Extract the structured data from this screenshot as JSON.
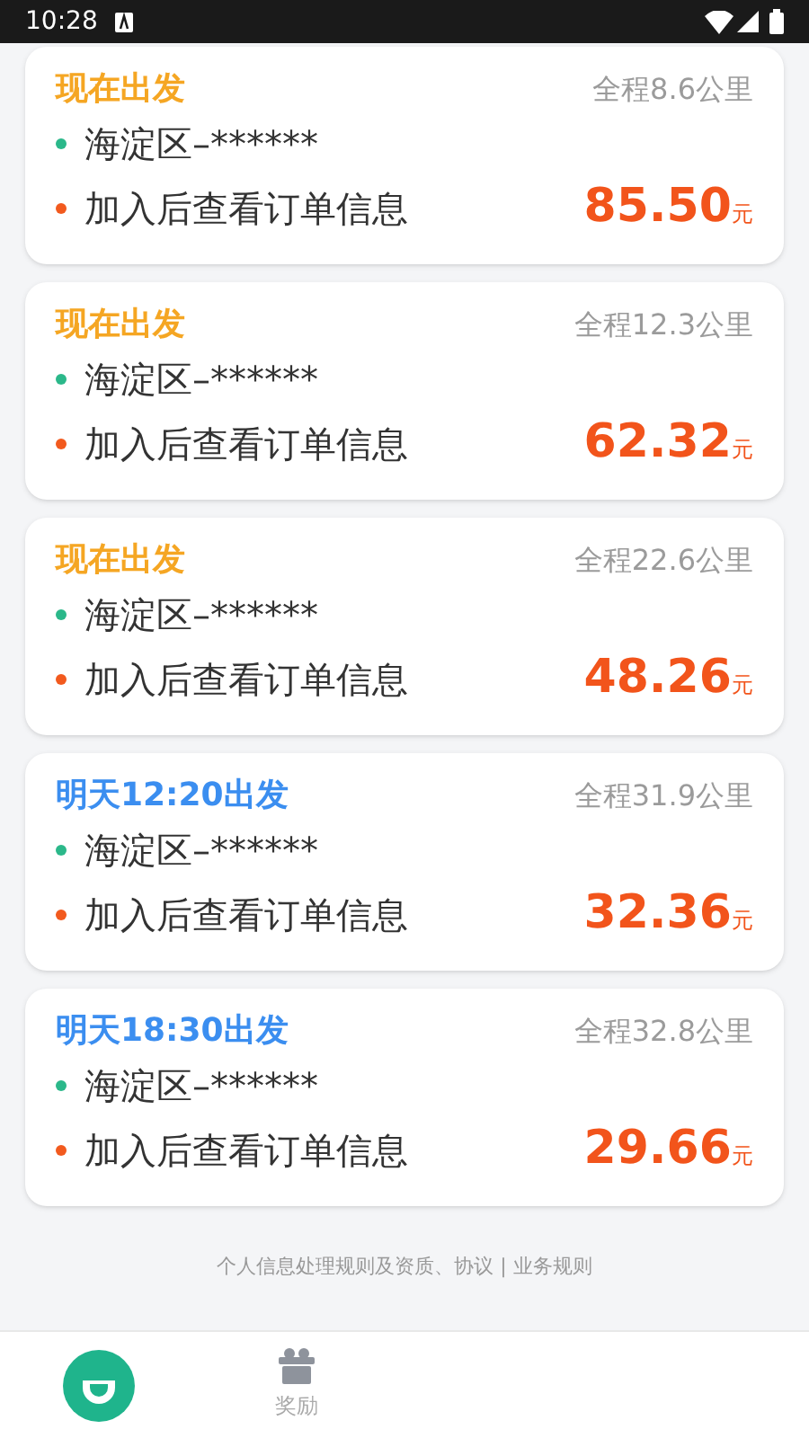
{
  "status_bar": {
    "time": "10:28"
  },
  "orders": [
    {
      "kind": "now",
      "departure": "现在出发",
      "distance": "全程8.6公里",
      "start": "海淀区–******",
      "end": "加入后查看订单信息",
      "price": "85.50",
      "unit": "元"
    },
    {
      "kind": "now",
      "departure": "现在出发",
      "distance": "全程12.3公里",
      "start": "海淀区–******",
      "end": "加入后查看订单信息",
      "price": "62.32",
      "unit": "元"
    },
    {
      "kind": "now",
      "departure": "现在出发",
      "distance": "全程22.6公里",
      "start": "海淀区–******",
      "end": "加入后查看订单信息",
      "price": "48.26",
      "unit": "元"
    },
    {
      "kind": "scheduled",
      "departure": "明天12:20出发",
      "distance": "全程31.9公里",
      "start": "海淀区–******",
      "end": "加入后查看订单信息",
      "price": "32.36",
      "unit": "元"
    },
    {
      "kind": "scheduled",
      "departure": "明天18:30出发",
      "distance": "全程32.8公里",
      "start": "海淀区–******",
      "end": "加入后查看订单信息",
      "price": "29.66",
      "unit": "元"
    }
  ],
  "footer": {
    "links": "个人信息处理规则及资质、协议 | 业务规则"
  },
  "nav": [
    {
      "kind": "home",
      "selected": true
    },
    {
      "kind": "gift",
      "label": "奖励",
      "selected": false
    }
  ]
}
